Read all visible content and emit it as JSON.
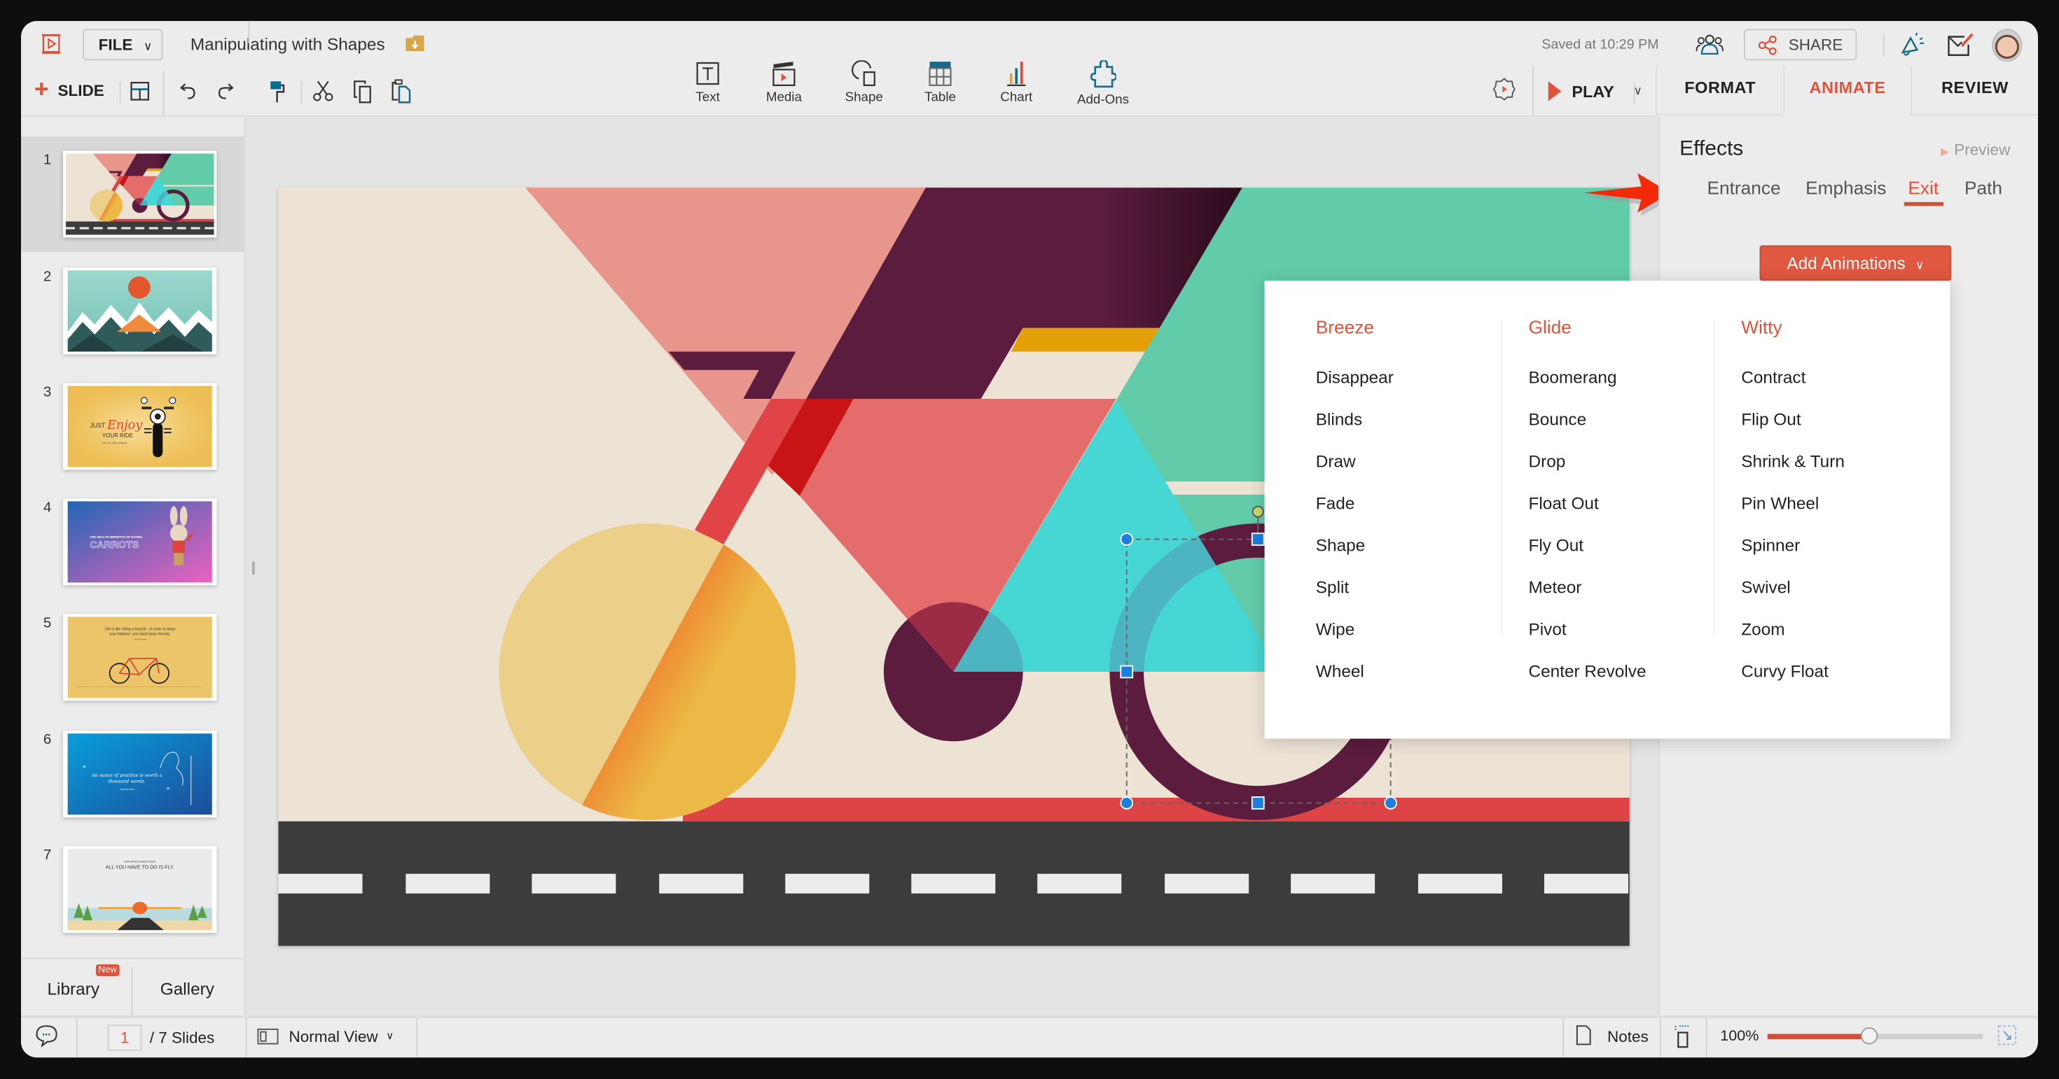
{
  "app": {
    "title": "Manipulating with Shapes",
    "file_label": "FILE",
    "saved_status": "Saved at 10:29 PM",
    "share_label": "SHARE"
  },
  "toolbar": {
    "slide_label": "SLIDE",
    "insert": [
      {
        "label": "Text",
        "icon": "text-box-icon"
      },
      {
        "label": "Media",
        "icon": "clapperboard-icon"
      },
      {
        "label": "Shape",
        "icon": "shape-icon"
      },
      {
        "label": "Table",
        "icon": "table-icon"
      },
      {
        "label": "Chart",
        "icon": "bar-chart-icon"
      },
      {
        "label": "Add-Ons",
        "icon": "puzzle-icon"
      }
    ],
    "play_label": "PLAY"
  },
  "tabs": [
    {
      "label": "FORMAT"
    },
    {
      "label": "ANIMATE",
      "active": true
    },
    {
      "label": "REVIEW"
    }
  ],
  "effects": {
    "title": "Effects",
    "preview_label": "Preview",
    "tabs": [
      "Entrance",
      "Emphasis",
      "Exit",
      "Path"
    ],
    "active_tab": "Exit",
    "add_button": "Add Animations"
  },
  "animations": {
    "columns": [
      {
        "title": "Breeze",
        "items": [
          "Disappear",
          "Blinds",
          "Draw",
          "Fade",
          "Shape",
          "Split",
          "Wipe",
          "Wheel"
        ]
      },
      {
        "title": "Glide",
        "items": [
          "Boomerang",
          "Bounce",
          "Drop",
          "Float Out",
          "Fly Out",
          "Meteor",
          "Pivot",
          "Center Revolve"
        ]
      },
      {
        "title": "Witty",
        "items": [
          "Contract",
          "Flip Out",
          "Shrink & Turn",
          "Pin Wheel",
          "Spinner",
          "Swivel",
          "Zoom",
          "Curvy Float"
        ]
      }
    ]
  },
  "slides": [
    {
      "number": "1",
      "selected": true
    },
    {
      "number": "2"
    },
    {
      "number": "3",
      "just": "JUST",
      "enjoy": "Enjoy",
      "ride": "YOUR RIDE",
      "tagline": "FEEL THE FRESH BREEZE"
    },
    {
      "number": "4",
      "heading": "THE HEALTH BENEFITS OF EATING",
      "title": "CARROTS"
    },
    {
      "number": "5",
      "quote_1": "Life is like riding a bicycle - in order to keep",
      "quote_2": "your balance, you must keep moving.",
      "author": "- Albert Einstein"
    },
    {
      "number": "6",
      "quote_1": "An ounce of practice is worth a",
      "quote_2": "thousand words.",
      "author": "- Mahatma Gandhi"
    },
    {
      "number": "7",
      "kicker": "YOUR WINGS ALREADY EXIST.",
      "title": "ALL YOU HAVE TO DO IS FLY."
    }
  ],
  "sidebar": {
    "library": "Library",
    "new_badge": "New",
    "gallery": "Gallery"
  },
  "status": {
    "current_page": "1",
    "total": "/ 7 Slides",
    "view": "Normal View",
    "notes": "Notes",
    "zoom": "100%",
    "zoom_slider_fraction": 0.47
  },
  "colors": {
    "accent": "#e0533b",
    "slide_bg": "#ece3d5",
    "purple": "#5b1c3e",
    "teal": "#62cba9",
    "cyan": "#46d6d3",
    "coral": "#e46c6b",
    "pink": "#e8958b",
    "road": "#3c3c3c"
  }
}
